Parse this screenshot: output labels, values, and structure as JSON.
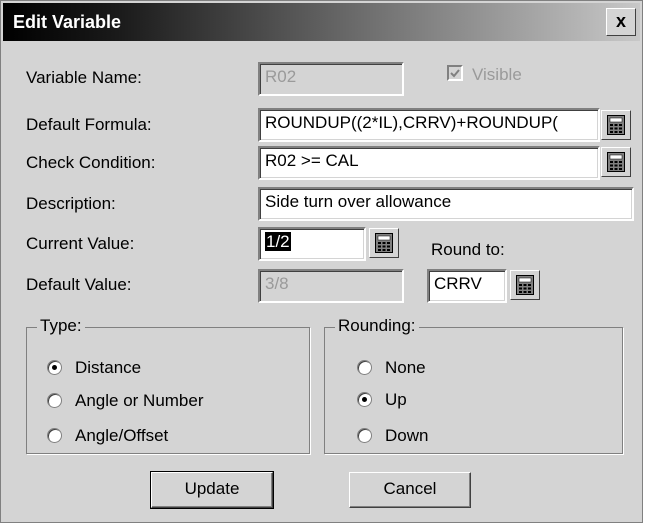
{
  "window": {
    "title": "Edit Variable",
    "close_label": "x"
  },
  "fields": {
    "variable_name": {
      "label": "Variable Name:",
      "value": "R02"
    },
    "visible": {
      "label": "Visible",
      "checked": true
    },
    "default_formula": {
      "label": "Default Formula:",
      "value": "ROUNDUP((2*IL),CRRV)+ROUNDUP("
    },
    "check_condition": {
      "label": "Check Condition:",
      "value": "R02 >= CAL"
    },
    "description": {
      "label": "Description:",
      "value": "Side turn over allowance"
    },
    "current_value": {
      "label": "Current Value:",
      "value": "1/2"
    },
    "round_to": {
      "label": "Round to:",
      "value": "CRRV"
    },
    "default_value": {
      "label": "Default Value:",
      "value": "3/8"
    }
  },
  "type_group": {
    "label": "Type:",
    "options": [
      "Distance",
      "Angle or Number",
      "Angle/Offset"
    ],
    "selected": "Distance"
  },
  "rounding_group": {
    "label": "Rounding:",
    "options": [
      "None",
      "Up",
      "Down"
    ],
    "selected": "Up"
  },
  "buttons": {
    "update": "Update",
    "cancel": "Cancel"
  },
  "icons": {
    "calculator": "calculator-icon"
  },
  "colors": {
    "dialog_bg": "#d4d4d4",
    "title_start": "#000000",
    "title_end": "#c8c8c8"
  }
}
